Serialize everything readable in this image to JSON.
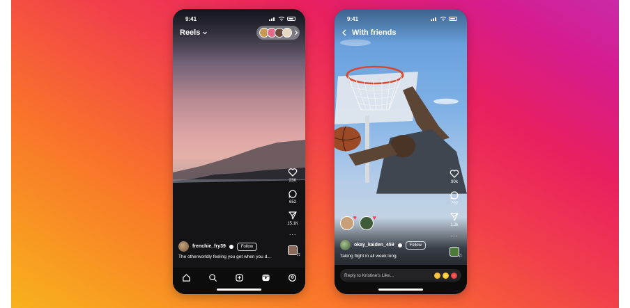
{
  "left_phone": {
    "status_time": "9:41",
    "header_title": "Reels",
    "rail": {
      "likes": "23K",
      "comments": "652",
      "shares": "15.1K"
    },
    "username": "frenchie_fry39",
    "follow_label": "Follow",
    "caption": "The otherworldly feeling you get when you d..."
  },
  "right_phone": {
    "status_time": "9:41",
    "header_title": "With friends",
    "rail": {
      "likes": "90k",
      "comments": "702",
      "shares": "1.2k"
    },
    "username": "okay_kaiden_459",
    "follow_label": "Follow",
    "caption": "Taking flight in all week long.",
    "reply_placeholder": "Reply to Kristine's Like..."
  },
  "colors": {
    "background_gradient": [
      "#f7b21c",
      "#f9742a",
      "#f23d4c",
      "#e8205f",
      "#d61c8d",
      "#c92aaa"
    ],
    "phone_frame": "#0d0d0f",
    "like_heart": "#ff3b5c"
  },
  "icons": {
    "nav": [
      "home-icon",
      "search-icon",
      "create-icon",
      "reels-icon",
      "profile-icon"
    ],
    "rail": [
      "heart-icon",
      "comment-icon",
      "share-icon",
      "more-icon",
      "audio-icon"
    ]
  }
}
